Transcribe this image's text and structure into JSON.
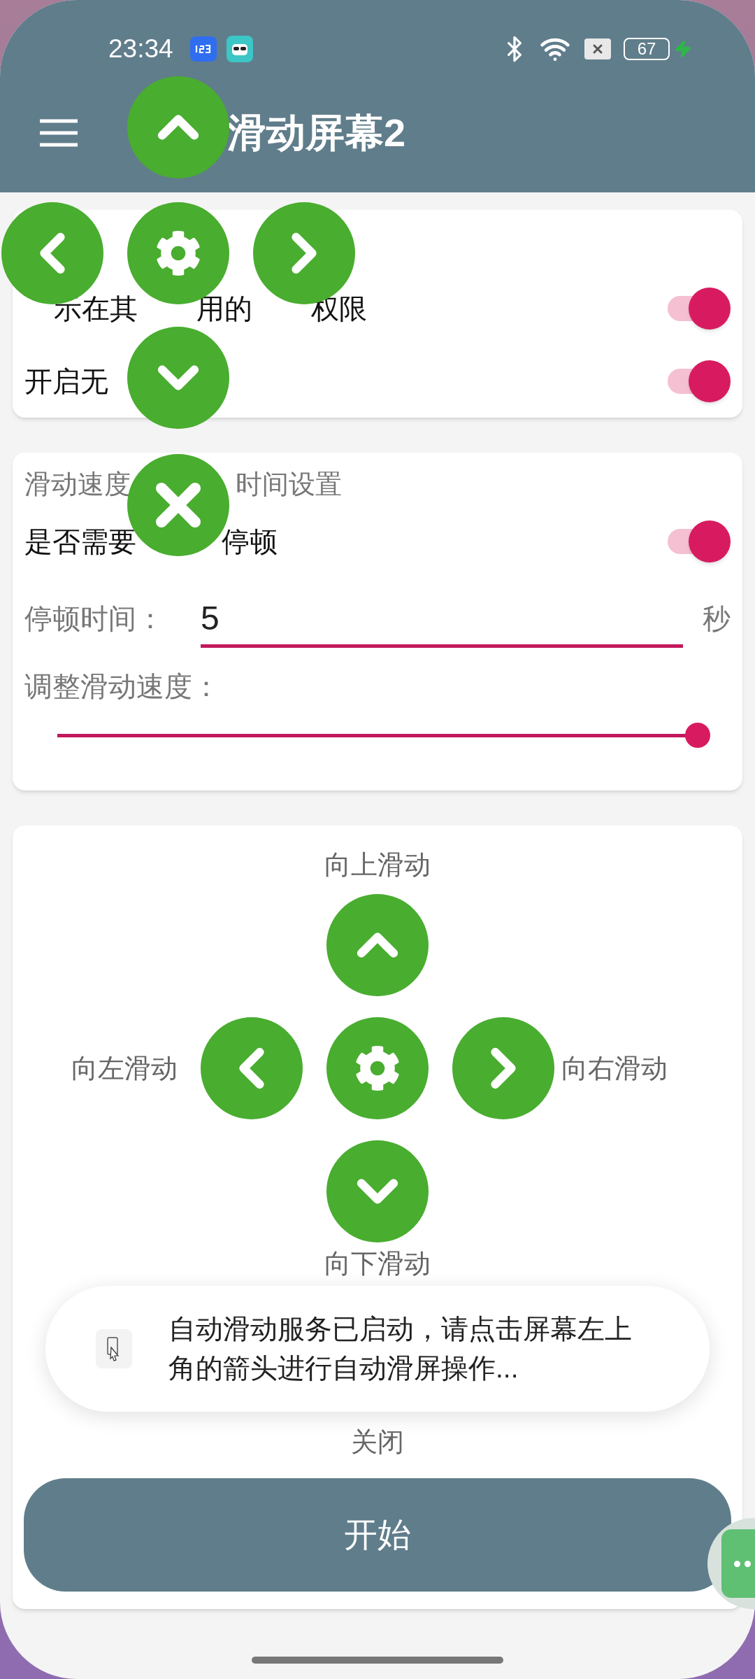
{
  "status_bar": {
    "time": "23:34",
    "battery": "67"
  },
  "app_bar": {
    "title": "滑动屏幕2"
  },
  "permissions_card": {
    "rows": [
      {
        "segments": [
          "示在其",
          "用的",
          "权限"
        ],
        "on": true
      },
      {
        "segments": [
          "开启无"
        ],
        "on": true
      }
    ]
  },
  "settings_card": {
    "title_segments": [
      "滑动速度",
      "时间设置"
    ],
    "pause_row": {
      "segments": [
        "是否需要",
        "停顿"
      ],
      "on": true
    },
    "pause_field": {
      "label": "停顿时间：",
      "value": "5",
      "unit": "秒"
    },
    "speed": {
      "label": "调整滑动速度：",
      "level": 1.0
    }
  },
  "controls_card": {
    "up": "向上滑动",
    "left": "向左滑动",
    "right": "向右滑动",
    "down": "向下滑动",
    "close": "关闭",
    "start": "开始"
  },
  "toast": {
    "message": "自动滑动服务已启动，请点击屏幕左上角的箭头进行自动滑屏操作..."
  }
}
